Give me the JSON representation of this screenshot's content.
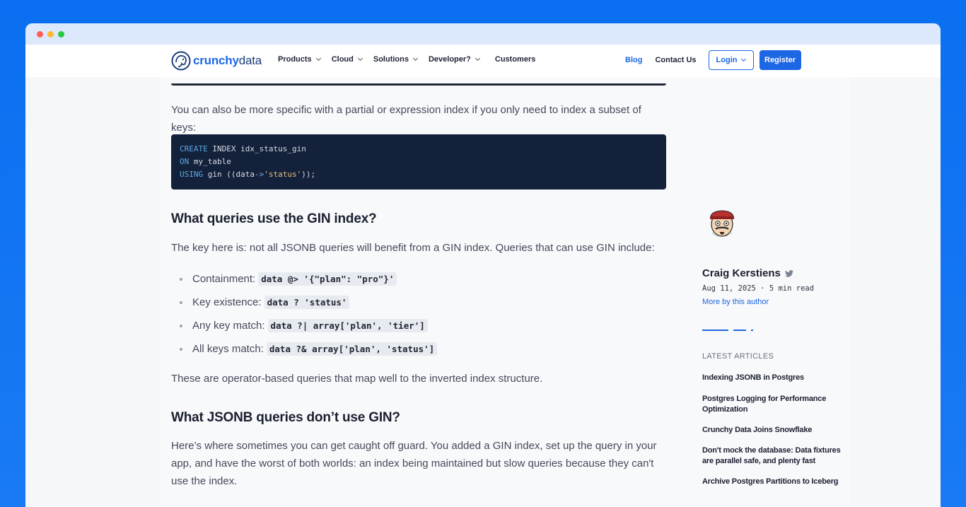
{
  "window": {
    "traffic_lights": [
      "#ff5f57",
      "#febc2e",
      "#28c840"
    ]
  },
  "brand": {
    "logo_part1": "crunchy",
    "logo_part2": "data"
  },
  "nav": {
    "items": [
      {
        "label": "Products"
      },
      {
        "label": "Cloud"
      },
      {
        "label": "Solutions"
      },
      {
        "label": "Developer?"
      },
      {
        "label": "Customers"
      }
    ],
    "blog": "Blog",
    "contact": "Contact Us",
    "login": "Login",
    "register": "Register"
  },
  "article": {
    "intro_para": "You can also be more specific with a partial or expression index if you only need to index a subset of keys:",
    "code": {
      "l1_kw": "CREATE",
      "l1_rest": " INDEX idx_status_gin",
      "l2_kw": "ON",
      "l2_rest": " my_table",
      "l3_kw": "USING",
      "l3_a": " gin ((data",
      "l3_op": "->",
      "l3_str": "'status'",
      "l3_b": "));"
    },
    "h2_gin": "What queries use the GIN index?",
    "gin_para": "The key here is: not all JSONB queries will benefit from a GIN index. Queries that can use GIN include:",
    "ops": [
      {
        "label": "Containment:",
        "code": "data @> '{\"plan\": \"pro\"}'"
      },
      {
        "label": "Key existence:",
        "code": "data ? 'status'"
      },
      {
        "label": "Any key match:",
        "code": "data ?| array['plan', 'tier']"
      },
      {
        "label": "All keys match:",
        "code": "data ?& array['plan', 'status']"
      }
    ],
    "operator_para": "These are operator-based queries that map well to the inverted index structure.",
    "h2_nogin": "What JSONB queries don’t use GIN?",
    "nogin_para": "Here’s where sometimes you can get caught off guard. You added a GIN index, set up the query in your app, and have the worst of both worlds: an index being maintained but slow queries because they can't use the index."
  },
  "author": {
    "name": "Craig Kerstiens",
    "meta": "Aug 11, 2025 · 5 min read",
    "more": "More by this author"
  },
  "latest": {
    "title": "LATEST ARTICLES",
    "items": [
      "Indexing JSONB in Postgres",
      "Postgres Logging for Performance Optimization",
      "Crunchy Data Joins Snowflake",
      "Don't mock the database: Data fixtures are parallel safe, and plenty fast",
      "Archive Postgres Partitions to Iceberg"
    ]
  },
  "colors": {
    "accent": "#1d66e4",
    "code_bg": "#14213a"
  }
}
